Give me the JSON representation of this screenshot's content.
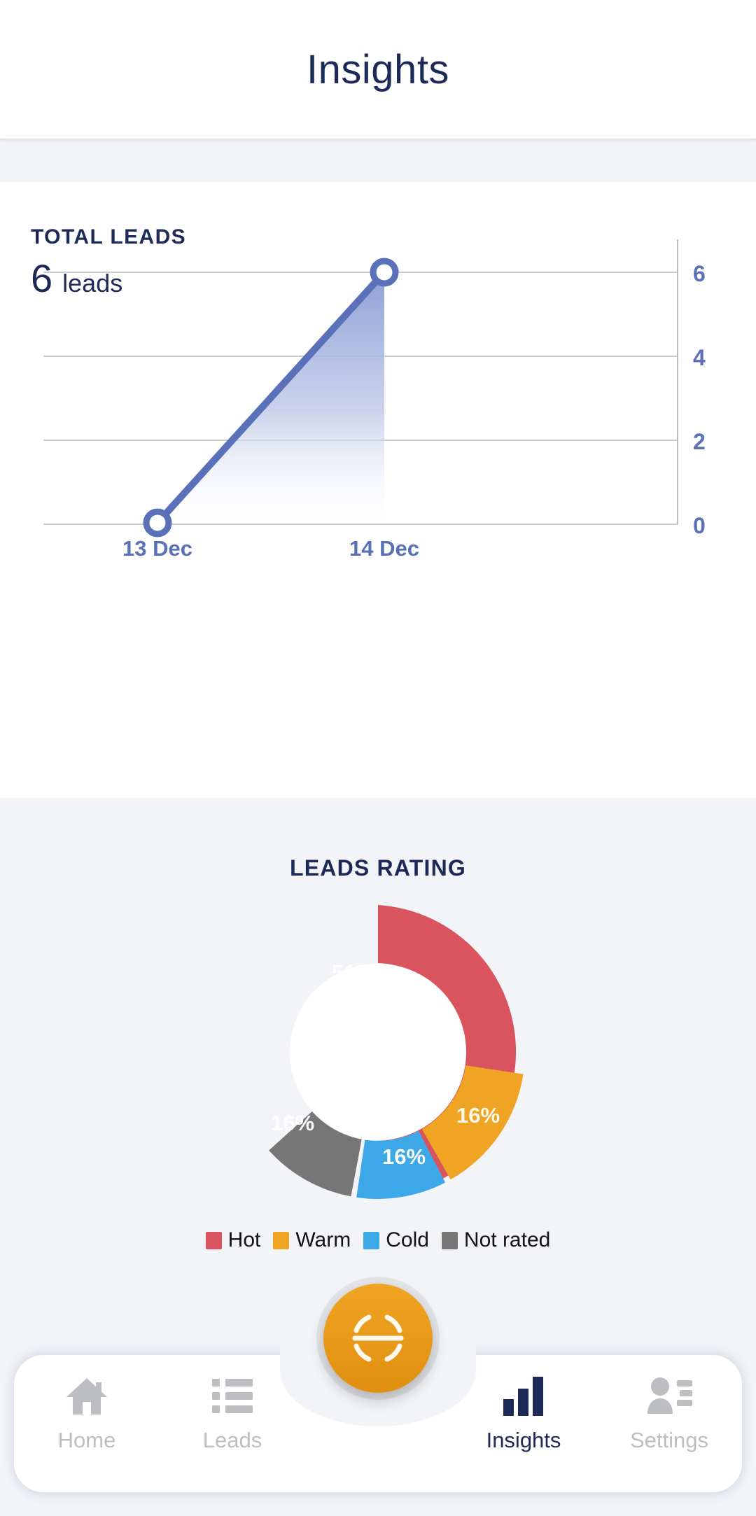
{
  "header": {
    "title": "Insights"
  },
  "total_leads": {
    "kicker": "TOTAL LEADS",
    "count": "6",
    "unit": "leads"
  },
  "rating": {
    "title": "LEADS RATING"
  },
  "legend": [
    {
      "label": "Hot",
      "color": "#d9545e"
    },
    {
      "label": "Warm",
      "color": "#f0a424"
    },
    {
      "label": "Cold",
      "color": "#3da8e8"
    },
    {
      "label": "Not rated",
      "color": "#767676"
    }
  ],
  "nav": {
    "home": "Home",
    "leads": "Leads",
    "insights": "Insights",
    "settings": "Settings",
    "fab_icon": "scan-icon",
    "active": "Insights",
    "active_color": "#1d2a57",
    "inactive_color": "#bcbec2"
  },
  "chart_data": [
    {
      "type": "line",
      "title": "TOTAL LEADS",
      "x": [
        "13 Dec",
        "14 Dec"
      ],
      "values": [
        0,
        6
      ],
      "categories": [
        "13 Dec",
        "14 Dec"
      ],
      "yticks": [
        0,
        2,
        4,
        6
      ],
      "ylim": [
        0,
        6.6
      ],
      "xlabel": "",
      "ylabel": "",
      "grid": true,
      "legend": "none",
      "line_color": "#5a70b8",
      "fill_gradient": [
        "#8d9fd6",
        "#ffffff"
      ],
      "marker": "open-circle",
      "tick_label_color": "#5a70b8",
      "axis_color": "#9ea4b0"
    },
    {
      "type": "pie",
      "title": "LEADS RATING",
      "labels": [
        "Hot",
        "Warm",
        "Cold",
        "Not rated"
      ],
      "values": [
        51,
        16,
        16,
        16
      ],
      "value_labels": [
        "51%",
        "16%",
        "16%",
        "16%"
      ],
      "colors": [
        "#d9545e",
        "#f0a424",
        "#3da8e8",
        "#767676"
      ],
      "donut": true,
      "inner_radius_ratio": 0.55,
      "legend": "bottom",
      "start_angle": 0
    }
  ]
}
